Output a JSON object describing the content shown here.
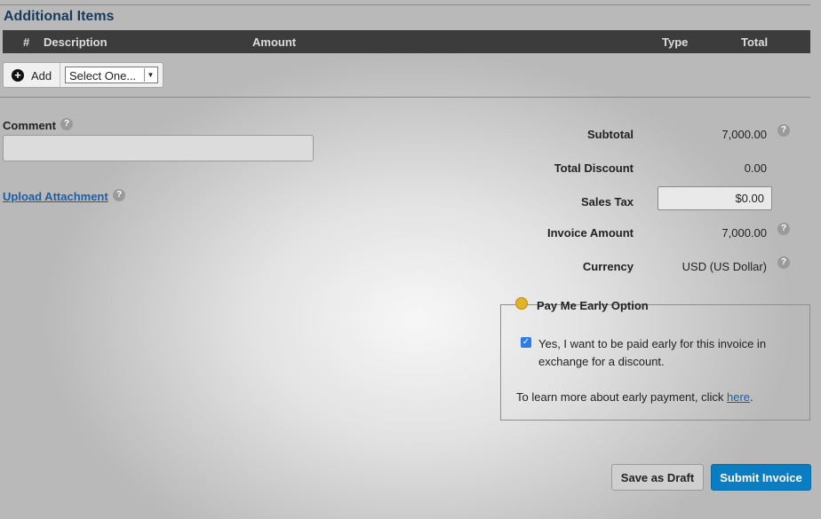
{
  "section": {
    "title": "Additional Items"
  },
  "table": {
    "columns": [
      "#",
      "Description",
      "Amount",
      "Type",
      "Total"
    ]
  },
  "add_bar": {
    "add_label": "Add",
    "select_value": "Select One...",
    "select_arrow": "▼"
  },
  "comment": {
    "label": "Comment",
    "value": ""
  },
  "upload": {
    "label": "Upload Attachment"
  },
  "help_glyph": "?",
  "summary": {
    "subtotal_label": "Subtotal",
    "subtotal_value": "7,000.00",
    "discount_label": "Total Discount",
    "discount_value": "0.00",
    "tax_label": "Sales Tax",
    "tax_value": "$0.00",
    "invoice_label": "Invoice Amount",
    "invoice_value": "7,000.00",
    "currency_label": "Currency",
    "currency_value": "USD (US Dollar)"
  },
  "early_pay": {
    "title": "Pay Me Early Option",
    "checkbox_checked": true,
    "checkbox_mark": "✓",
    "checkbox_text": "Yes, I want to be paid early for this invoice in exchange for a discount.",
    "learn_prefix": "To learn more about early payment, click ",
    "learn_link": "here",
    "learn_suffix": "."
  },
  "buttons": {
    "draft": "Save as Draft",
    "submit": "Submit Invoice"
  },
  "colors": {
    "header_bg": "#3c3c3c",
    "title": "#173b5c",
    "link": "#1d5ea8",
    "submit": "#0a7dc3",
    "coin": "#e3b22a"
  }
}
